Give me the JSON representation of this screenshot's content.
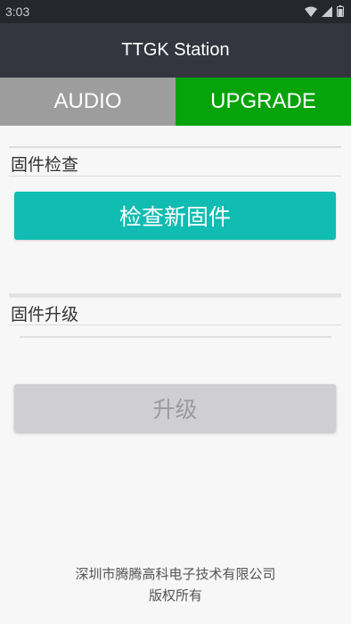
{
  "status_bar": {
    "time": "3:03",
    "icons": [
      "wifi-icon",
      "signal-icon",
      "battery-icon"
    ]
  },
  "app_bar": {
    "title": "TTGK Station"
  },
  "tabs": [
    {
      "label": "AUDIO",
      "selected": false,
      "color": "#9d9d9d"
    },
    {
      "label": "UPGRADE",
      "selected": true,
      "color": "#06a30a"
    }
  ],
  "firmware_check": {
    "section_label": "固件检查",
    "button_label": "检查新固件"
  },
  "firmware_upgrade": {
    "section_label": "固件升级",
    "progress": 0,
    "button_label": "升级",
    "button_enabled": false
  },
  "footer": {
    "company": "深圳市腾腾高科电子技术有限公司",
    "rights": "版权所有"
  },
  "colors": {
    "accent": "#11bcb2",
    "app_bar": "#34353f",
    "status_bar": "#25262e"
  }
}
